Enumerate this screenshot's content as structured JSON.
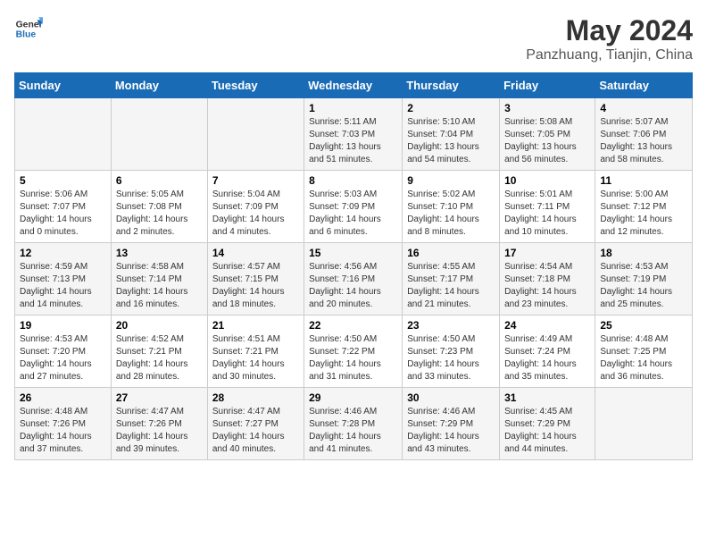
{
  "header": {
    "logo_line1": "General",
    "logo_line2": "Blue",
    "title": "May 2024",
    "subtitle": "Panzhuang, Tianjin, China"
  },
  "weekdays": [
    "Sunday",
    "Monday",
    "Tuesday",
    "Wednesday",
    "Thursday",
    "Friday",
    "Saturday"
  ],
  "weeks": [
    [
      {
        "day": "",
        "info": ""
      },
      {
        "day": "",
        "info": ""
      },
      {
        "day": "",
        "info": ""
      },
      {
        "day": "1",
        "info": "Sunrise: 5:11 AM\nSunset: 7:03 PM\nDaylight: 13 hours and 51 minutes."
      },
      {
        "day": "2",
        "info": "Sunrise: 5:10 AM\nSunset: 7:04 PM\nDaylight: 13 hours and 54 minutes."
      },
      {
        "day": "3",
        "info": "Sunrise: 5:08 AM\nSunset: 7:05 PM\nDaylight: 13 hours and 56 minutes."
      },
      {
        "day": "4",
        "info": "Sunrise: 5:07 AM\nSunset: 7:06 PM\nDaylight: 13 hours and 58 minutes."
      }
    ],
    [
      {
        "day": "5",
        "info": "Sunrise: 5:06 AM\nSunset: 7:07 PM\nDaylight: 14 hours and 0 minutes."
      },
      {
        "day": "6",
        "info": "Sunrise: 5:05 AM\nSunset: 7:08 PM\nDaylight: 14 hours and 2 minutes."
      },
      {
        "day": "7",
        "info": "Sunrise: 5:04 AM\nSunset: 7:09 PM\nDaylight: 14 hours and 4 minutes."
      },
      {
        "day": "8",
        "info": "Sunrise: 5:03 AM\nSunset: 7:09 PM\nDaylight: 14 hours and 6 minutes."
      },
      {
        "day": "9",
        "info": "Sunrise: 5:02 AM\nSunset: 7:10 PM\nDaylight: 14 hours and 8 minutes."
      },
      {
        "day": "10",
        "info": "Sunrise: 5:01 AM\nSunset: 7:11 PM\nDaylight: 14 hours and 10 minutes."
      },
      {
        "day": "11",
        "info": "Sunrise: 5:00 AM\nSunset: 7:12 PM\nDaylight: 14 hours and 12 minutes."
      }
    ],
    [
      {
        "day": "12",
        "info": "Sunrise: 4:59 AM\nSunset: 7:13 PM\nDaylight: 14 hours and 14 minutes."
      },
      {
        "day": "13",
        "info": "Sunrise: 4:58 AM\nSunset: 7:14 PM\nDaylight: 14 hours and 16 minutes."
      },
      {
        "day": "14",
        "info": "Sunrise: 4:57 AM\nSunset: 7:15 PM\nDaylight: 14 hours and 18 minutes."
      },
      {
        "day": "15",
        "info": "Sunrise: 4:56 AM\nSunset: 7:16 PM\nDaylight: 14 hours and 20 minutes."
      },
      {
        "day": "16",
        "info": "Sunrise: 4:55 AM\nSunset: 7:17 PM\nDaylight: 14 hours and 21 minutes."
      },
      {
        "day": "17",
        "info": "Sunrise: 4:54 AM\nSunset: 7:18 PM\nDaylight: 14 hours and 23 minutes."
      },
      {
        "day": "18",
        "info": "Sunrise: 4:53 AM\nSunset: 7:19 PM\nDaylight: 14 hours and 25 minutes."
      }
    ],
    [
      {
        "day": "19",
        "info": "Sunrise: 4:53 AM\nSunset: 7:20 PM\nDaylight: 14 hours and 27 minutes."
      },
      {
        "day": "20",
        "info": "Sunrise: 4:52 AM\nSunset: 7:21 PM\nDaylight: 14 hours and 28 minutes."
      },
      {
        "day": "21",
        "info": "Sunrise: 4:51 AM\nSunset: 7:21 PM\nDaylight: 14 hours and 30 minutes."
      },
      {
        "day": "22",
        "info": "Sunrise: 4:50 AM\nSunset: 7:22 PM\nDaylight: 14 hours and 31 minutes."
      },
      {
        "day": "23",
        "info": "Sunrise: 4:50 AM\nSunset: 7:23 PM\nDaylight: 14 hours and 33 minutes."
      },
      {
        "day": "24",
        "info": "Sunrise: 4:49 AM\nSunset: 7:24 PM\nDaylight: 14 hours and 35 minutes."
      },
      {
        "day": "25",
        "info": "Sunrise: 4:48 AM\nSunset: 7:25 PM\nDaylight: 14 hours and 36 minutes."
      }
    ],
    [
      {
        "day": "26",
        "info": "Sunrise: 4:48 AM\nSunset: 7:26 PM\nDaylight: 14 hours and 37 minutes."
      },
      {
        "day": "27",
        "info": "Sunrise: 4:47 AM\nSunset: 7:26 PM\nDaylight: 14 hours and 39 minutes."
      },
      {
        "day": "28",
        "info": "Sunrise: 4:47 AM\nSunset: 7:27 PM\nDaylight: 14 hours and 40 minutes."
      },
      {
        "day": "29",
        "info": "Sunrise: 4:46 AM\nSunset: 7:28 PM\nDaylight: 14 hours and 41 minutes."
      },
      {
        "day": "30",
        "info": "Sunrise: 4:46 AM\nSunset: 7:29 PM\nDaylight: 14 hours and 43 minutes."
      },
      {
        "day": "31",
        "info": "Sunrise: 4:45 AM\nSunset: 7:29 PM\nDaylight: 14 hours and 44 minutes."
      },
      {
        "day": "",
        "info": ""
      }
    ]
  ]
}
